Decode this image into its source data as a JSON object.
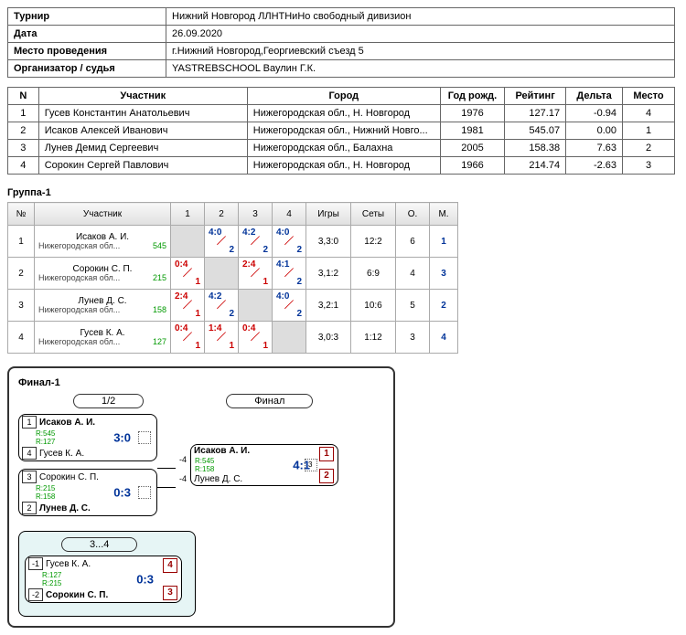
{
  "info": {
    "labels": {
      "tournament": "Турнир",
      "date": "Дата",
      "venue": "Место проведения",
      "org": "Организатор / судья"
    },
    "tournament": "Нижний Новгород ЛЛНТНиНо свободный дивизион",
    "date": "26.09.2020",
    "venue": "г.Нижний Новгород,Георгиевский съезд 5",
    "org": "YASTREBSCHOOL Ваулин Г.К."
  },
  "participants": {
    "headers": {
      "n": "N",
      "name": "Участник",
      "city": "Город",
      "year": "Год рожд.",
      "rating": "Рейтинг",
      "delta": "Дельта",
      "place": "Место"
    },
    "rows": [
      {
        "n": "1",
        "name": "Гусев Константин Анатольевич",
        "city": "Нижегородская обл., Н. Новгород",
        "year": "1976",
        "rating": "127.17",
        "delta": "-0.94",
        "place": "4"
      },
      {
        "n": "2",
        "name": "Исаков Алексей Иванович",
        "city": "Нижегородская обл., Нижний Новго...",
        "year": "1981",
        "rating": "545.07",
        "delta": "0.00",
        "place": "1"
      },
      {
        "n": "3",
        "name": "Лунев Демид Сергеевич",
        "city": "Нижегородская обл., Балахна",
        "year": "2005",
        "rating": "158.38",
        "delta": "7.63",
        "place": "2"
      },
      {
        "n": "4",
        "name": "Сорокин Сергей Павлович",
        "city": "Нижегородская обл., Н. Новгород",
        "year": "1966",
        "rating": "214.74",
        "delta": "-2.63",
        "place": "3"
      }
    ]
  },
  "group": {
    "title": "Группа-1",
    "headers": {
      "num": "№",
      "part": "Участник",
      "games": "Игры",
      "sets": "Сеты",
      "o": "О.",
      "m": "М."
    },
    "cols": [
      "1",
      "2",
      "3",
      "4"
    ],
    "rows": [
      {
        "n": "1",
        "name": "Исаков А. И.",
        "city": "Нижегородская обл...",
        "rt": "545",
        "cells": [
          null,
          {
            "t": "4:0",
            "b": "2",
            "w": true
          },
          {
            "t": "4:2",
            "b": "2",
            "w": true
          },
          {
            "t": "4:0",
            "b": "2",
            "w": true
          }
        ],
        "games": "3,3:0",
        "sets": "12:2",
        "o": "6",
        "m": "1"
      },
      {
        "n": "2",
        "name": "Сорокин С. П.",
        "city": "Нижегородская обл...",
        "rt": "215",
        "cells": [
          {
            "t": "0:4",
            "b": "1",
            "w": false
          },
          null,
          {
            "t": "2:4",
            "b": "1",
            "w": false
          },
          {
            "t": "4:1",
            "b": "2",
            "w": true
          }
        ],
        "games": "3,1:2",
        "sets": "6:9",
        "o": "4",
        "m": "3"
      },
      {
        "n": "3",
        "name": "Лунев Д. С.",
        "city": "Нижегородская обл...",
        "rt": "158",
        "cells": [
          {
            "t": "2:4",
            "b": "1",
            "w": false
          },
          {
            "t": "4:2",
            "b": "2",
            "w": true
          },
          null,
          {
            "t": "4:0",
            "b": "2",
            "w": true
          }
        ],
        "games": "3,2:1",
        "sets": "10:6",
        "o": "5",
        "m": "2"
      },
      {
        "n": "4",
        "name": "Гусев К. А.",
        "city": "Нижегородская обл...",
        "rt": "127",
        "cells": [
          {
            "t": "0:4",
            "b": "1",
            "w": false
          },
          {
            "t": "1:4",
            "b": "1",
            "w": false
          },
          {
            "t": "0:4",
            "b": "1",
            "w": false
          },
          null
        ],
        "games": "3,0:3",
        "sets": "1:12",
        "o": "3",
        "m": "4"
      }
    ]
  },
  "bracket": {
    "title": "Финал-1",
    "round_semi": "1/2",
    "round_final": "Финал",
    "round_34": "3...4",
    "fourth_label": "-4",
    "semi1": {
      "s1": "1",
      "p1": "Исаков А. И.",
      "r1": "R:545",
      "s2": "4",
      "p2": "Гусев К. А.",
      "r2": "R:127",
      "score": "3:0",
      "win": 1
    },
    "semi2": {
      "s1": "3",
      "p1": "Сорокин С. П.",
      "r1": "R:215",
      "s2": "2",
      "p2": "Лунев Д. С.",
      "r2": "R:158",
      "score": "0:3",
      "win": 2
    },
    "final": {
      "p1": "Исаков А. И.",
      "r1": "R:545",
      "p2": "Лунев Д. С.",
      "r2": "R:158",
      "score": "4:1",
      "place1": "1",
      "place2": "2",
      "dot": "3"
    },
    "third": {
      "s1": "-1",
      "p1": "Гусев К. А.",
      "r1": "R:127",
      "s2": "-2",
      "p2": "Сорокин С. П.",
      "r2": "R:215",
      "score": "0:3",
      "place1": "4",
      "place2": "3",
      "win": 2
    }
  }
}
